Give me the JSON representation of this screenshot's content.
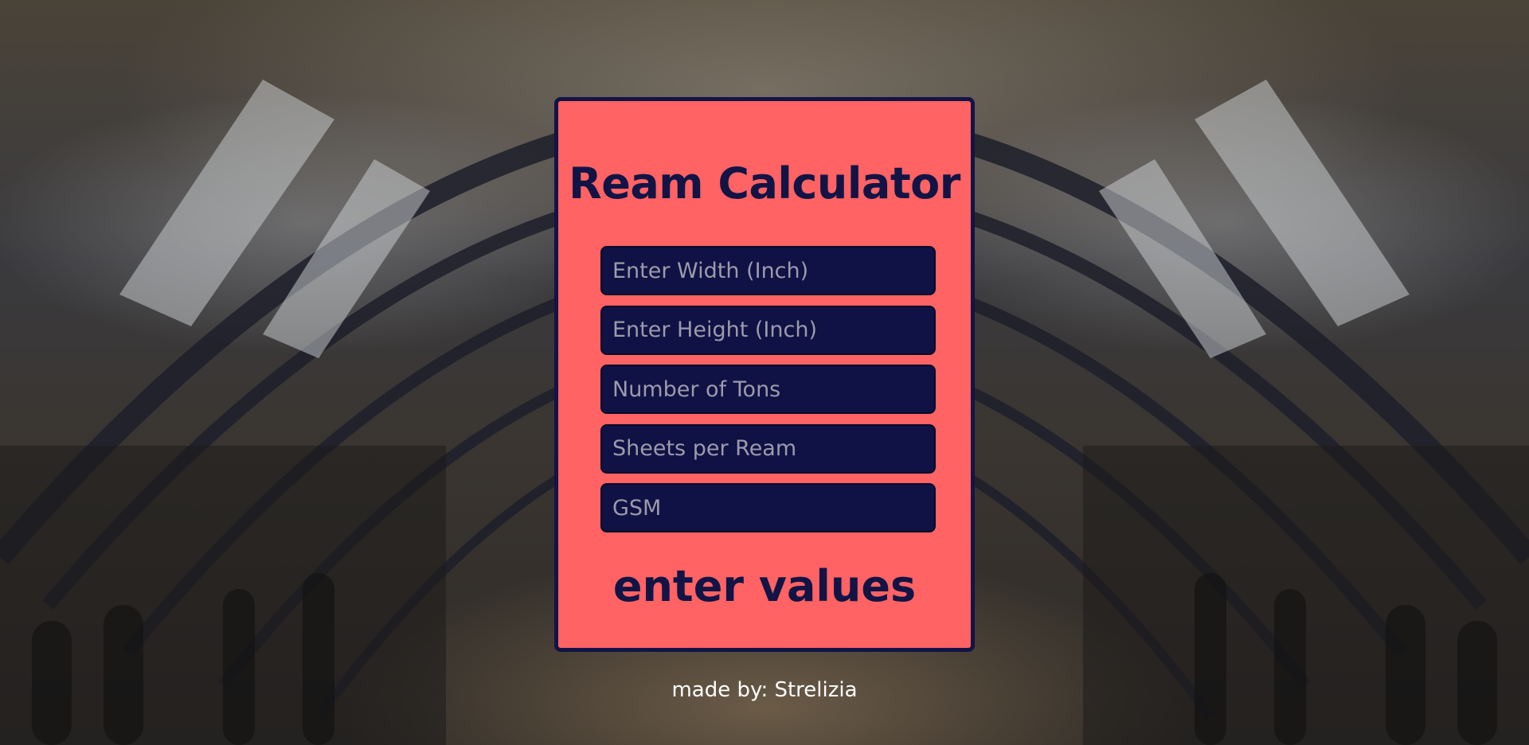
{
  "calculator": {
    "title": "Ream Calculator",
    "fields": [
      {
        "placeholder": "Enter Width (Inch)",
        "value": ""
      },
      {
        "placeholder": "Enter Height (Inch)",
        "value": ""
      },
      {
        "placeholder": "Number of Tons",
        "value": ""
      },
      {
        "placeholder": "Sheets per Ream",
        "value": ""
      },
      {
        "placeholder": "GSM",
        "value": ""
      }
    ],
    "result": "enter values"
  },
  "footer": {
    "text": "made by: Strelizia"
  },
  "colors": {
    "card_background": "#ff6363",
    "card_border": "#121445",
    "text_dark": "#121445",
    "input_background": "#101144",
    "footer_text": "#ffffff"
  }
}
